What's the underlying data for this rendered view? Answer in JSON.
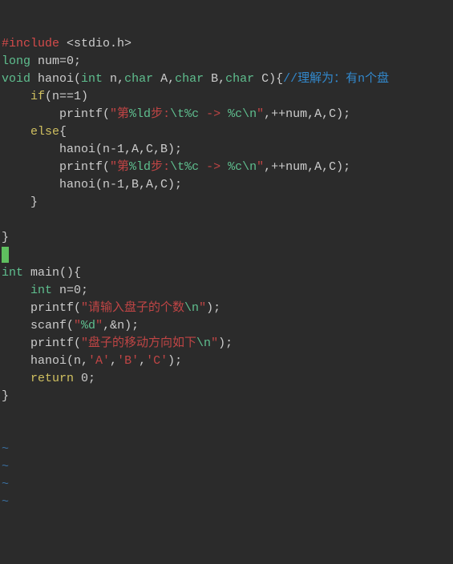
{
  "code": {
    "l1_inc": "#include",
    "l1_hdr": " <stdio.h>",
    "l2_type": "long",
    "l2_rest": " num=0;",
    "l3_type": "void",
    "l3_fn": " hanoi(",
    "l3_int": "int",
    "l3_p1": " n,",
    "l3_char1": "char",
    "l3_p2": " A,",
    "l3_char2": "char",
    "l3_p3": " B,",
    "l3_char3": "char",
    "l3_p4": " C){",
    "l3_cmt": "//理解为：有n个盘",
    "l4_if": "if",
    "l4_cond": "(n==1)",
    "l5_fn": "printf(",
    "l5_s1": "\"第",
    "l5_s2": "%ld",
    "l5_s3": "步:",
    "l5_s4": "\\t%c",
    "l5_s5": " -> ",
    "l5_s6": "%c\\n",
    "l5_s7": "\"",
    "l5_args": ",++num,A,C);",
    "l6_else": "else",
    "l6_brace": "{",
    "l7": "hanoi(n-1,A,C,B);",
    "l8_fn": "printf(",
    "l8_s1": "\"第",
    "l8_s2": "%ld",
    "l8_s3": "步:",
    "l8_s4": "\\t%c",
    "l8_s5": " -> ",
    "l8_s6": "%c\\n",
    "l8_s7": "\"",
    "l8_args": ",++num,A,C);",
    "l9": "hanoi(n-1,B,A,C);",
    "l10": "}",
    "l11": "",
    "l12": "}",
    "l14_type": "int",
    "l14_fn": " main(){",
    "l15_type": "int",
    "l15_rest": " n=0;",
    "l16_fn": "printf(",
    "l16_s1": "\"请输入盘子的个数",
    "l16_s2": "\\n",
    "l16_s3": "\"",
    "l16_end": ");",
    "l17_fn": "scanf(",
    "l17_s1": "\"",
    "l17_s2": "%d",
    "l17_s3": "\"",
    "l17_args": ",&n);",
    "l18_fn": "printf(",
    "l18_s1": "\"盘子的移动方向如下",
    "l18_s2": "\\n",
    "l18_s3": "\"",
    "l18_end": ");",
    "l19_a": "hanoi(n,",
    "l19_c1": "'A'",
    "l19_b": ",",
    "l19_c2": "'B'",
    "l19_c": ",",
    "l19_c3": "'C'",
    "l19_d": ");",
    "l20_ret": "return",
    "l20_val": " 0;",
    "l21": "}",
    "tilde": "~"
  }
}
